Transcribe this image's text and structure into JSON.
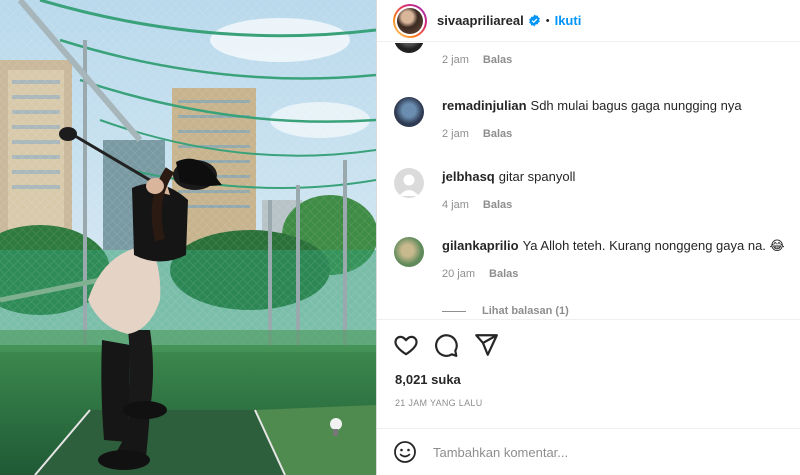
{
  "post": {
    "username": "sivaapriliareal",
    "separator": "•",
    "follow_label": "Ikuti",
    "verified": true
  },
  "comments": [
    {
      "user": "",
      "text": "",
      "time": "2 jam",
      "reply_label": "Balas"
    },
    {
      "user": "remadinjulian",
      "text": "Sdh mulai bagus gaga nungging nya",
      "time": "2 jam",
      "reply_label": "Balas"
    },
    {
      "user": "jelbhasq",
      "text": "gitar spanyoll",
      "time": "4 jam",
      "reply_label": "Balas"
    },
    {
      "user": "gilankaprilio",
      "text": "Ya Alloh teteh. Kurang nonggeng gaya na. 😂",
      "time": "20 jam",
      "reply_label": "Balas"
    }
  ],
  "view_replies": "Lihat balasan (1)",
  "actions": {
    "like_icon": "heart-icon",
    "comment_icon": "comment-bubble-icon",
    "share_icon": "send-icon"
  },
  "likes_text": "8,021 suka",
  "timestamp": "21 JAM YANG LALU",
  "add_comment": {
    "emoji_icon": "smiley-icon",
    "placeholder": "Tambahkan komentar..."
  },
  "colors": {
    "accent": "#0095f6",
    "secondary_text": "#8e8e8e",
    "primary_text": "#262626"
  }
}
